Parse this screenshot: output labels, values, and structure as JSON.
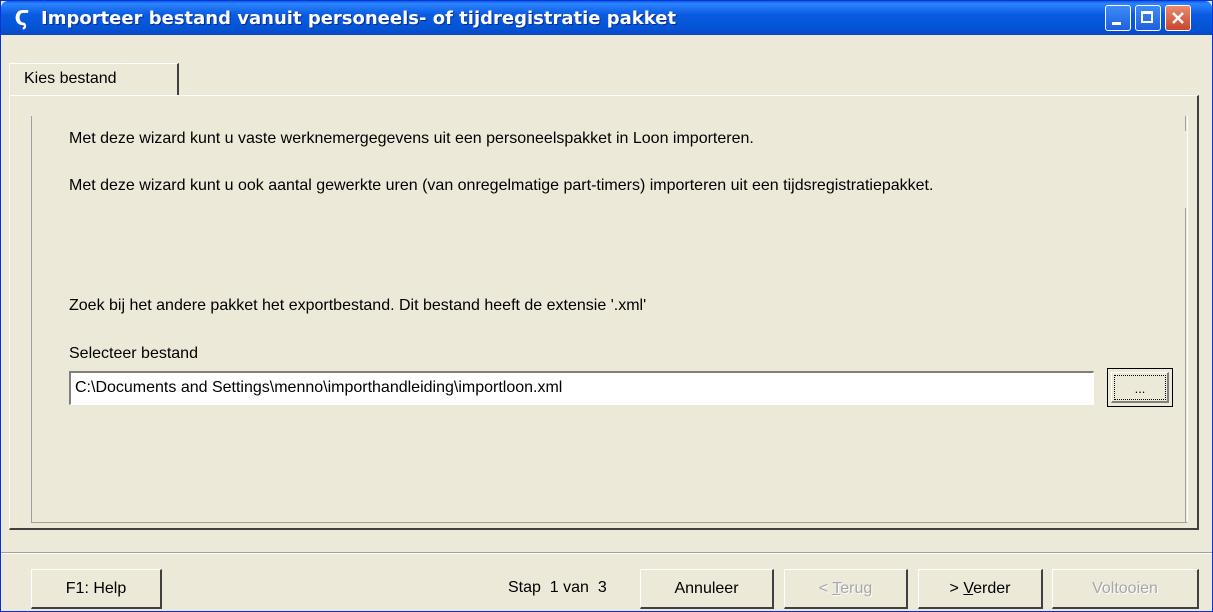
{
  "window": {
    "title": "Importeer bestand vanuit personeels- of tijdregistratie pakket",
    "app_icon": "Ϛ"
  },
  "tabs": [
    {
      "label": "Kies bestand",
      "active": true
    }
  ],
  "intro": {
    "line1": "Met deze wizard kunt u vaste werknemergegevens uit een personeelspakket in Loon importeren.",
    "line2": "Met deze wizard kunt u ook aantal gewerkte uren (van onregelmatige part-timers) importeren uit een tijdsregistratiepakket."
  },
  "instruction": "Zoek bij het andere pakket het exportbestand. Dit bestand heeft de extensie '.xml'",
  "file": {
    "label": "Selecteer bestand",
    "value": "C:\\Documents and Settings\\menno\\importhandleiding\\importloon.xml",
    "browse_label": "..."
  },
  "footer": {
    "help": "F1: Help",
    "step": "Stap  1 van  3",
    "cancel": "Annuleer",
    "back_prefix": "< ",
    "back_mnemonic": "T",
    "back_rest": "erug",
    "next_prefix": "> ",
    "next_mnemonic": "V",
    "next_rest": "erder",
    "finish": "Voltooien"
  },
  "colors": {
    "titlebar": "#0A5BE0",
    "window_bg": "#ECE9D8",
    "close_button": "#C8462A",
    "disabled_text": "#A7A6AA"
  }
}
